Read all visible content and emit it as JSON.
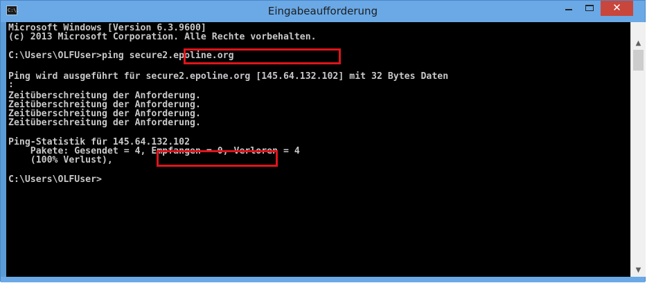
{
  "window": {
    "title": "Eingabeaufforderung",
    "icon_text": "C:\\."
  },
  "controls": {
    "minimize": "minimize",
    "maximize": "maximize",
    "close": "✕"
  },
  "console": {
    "lines": [
      "Microsoft Windows [Version 6.3.9600]",
      "(c) 2013 Microsoft Corporation. Alle Rechte vorbehalten.",
      "",
      "C:\\Users\\OLFUser>ping secure2.epoline.org",
      "",
      "Ping wird ausgeführt für secure2.epoline.org [145.64.132.102] mit 32 Bytes Daten",
      ":",
      "Zeitüberschreitung der Anforderung.",
      "Zeitüberschreitung der Anforderung.",
      "Zeitüberschreitung der Anforderung.",
      "Zeitüberschreitung der Anforderung.",
      "",
      "Ping-Statistik für 145.64.132.102",
      "    Pakete: Gesendet = 4, Empfangen = 0, Verloren = 4",
      "    (100% Verlust),",
      "",
      "C:\\Users\\OLFUser>"
    ]
  },
  "highlights": {
    "host": "secure2.epoline.org",
    "ip": "145.64.132.102",
    "color": "#e0141b"
  },
  "scrollbar": {
    "up": "▲",
    "down": "▼"
  }
}
